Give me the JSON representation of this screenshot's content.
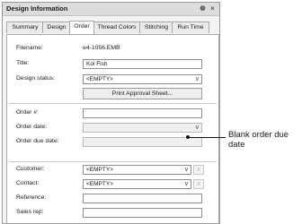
{
  "panel": {
    "title": "Design Information",
    "pin_glyph": "❁",
    "close_glyph": "×"
  },
  "tabs": [
    {
      "label": "Summary",
      "active": false
    },
    {
      "label": "Design",
      "active": false
    },
    {
      "label": "Order",
      "active": true
    },
    {
      "label": "Thread Colors",
      "active": false
    },
    {
      "label": "Stitching",
      "active": false
    },
    {
      "label": "Run Time",
      "active": false
    }
  ],
  "form": {
    "filename_label": "Filename:",
    "filename_value": "e4-1056.EMB",
    "title_label": "Title:",
    "title_value": "Koi Fish",
    "status_label": "Design status:",
    "status_value": "<EMPTY>",
    "print_button": "Print Approval Sheet...",
    "order_no_label": "Order #:",
    "order_no_value": "",
    "order_date_label": "Order date:",
    "order_date_value": "",
    "order_due_label": "Order due date:",
    "order_due_value": "",
    "customer_label": "Customer:",
    "customer_value": "<EMPTY>",
    "contact_label": "Contact:",
    "contact_value": "<EMPTY>",
    "reference_label": "Reference:",
    "reference_value": "",
    "salesrep_label": "Sales rep:",
    "salesrep_value": ""
  },
  "glyphs": {
    "chevron": "∨",
    "clear": "✕"
  },
  "callout": {
    "text": "Blank order due date"
  }
}
